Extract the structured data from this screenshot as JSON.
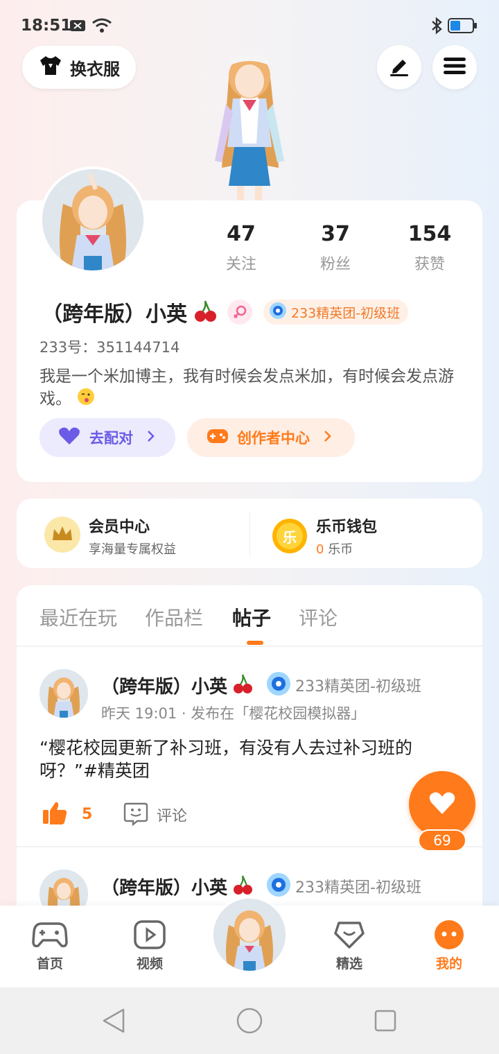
{
  "status": {
    "time": "18:51"
  },
  "header": {
    "outfit_label": "换衣服"
  },
  "profile": {
    "name": "（跨年版）小英",
    "id_line": "233号：351144714",
    "bio": "我是一个米加博主，我有时候会发点米加，有时候会发点游戏。",
    "badge": "233精英团-初级班",
    "stats": [
      {
        "value": "47",
        "label": "关注"
      },
      {
        "value": "37",
        "label": "粉丝"
      },
      {
        "value": "154",
        "label": "获赞"
      }
    ],
    "match_label": "去配对",
    "creator_label": "创作者中心"
  },
  "services": {
    "vip_title": "会员中心",
    "vip_sub": "享海量专属权益",
    "wallet_title": "乐币钱包",
    "wallet_amount": "0",
    "wallet_unit": "乐币",
    "coin_glyph": "乐"
  },
  "tabs": [
    {
      "label": "最近在玩"
    },
    {
      "label": "作品栏"
    },
    {
      "label": "帖子"
    },
    {
      "label": "评论"
    }
  ],
  "posts": [
    {
      "author": "（跨年版）小英",
      "badge": "233精英团-初级班",
      "meta": "昨天 19:01 · 发布在「樱花校园模拟器」",
      "text": "“樱花校园更新了补习班，有没有人去过补习班的呀？”#精英团",
      "likes": "5",
      "comment_label": "评论"
    },
    {
      "author": "（跨年版）小英",
      "badge": "233精英团-初级班"
    }
  ],
  "float": {
    "count": "69"
  },
  "bottom_nav": [
    {
      "label": "首页"
    },
    {
      "label": "视频"
    },
    {
      "label": "精选"
    },
    {
      "label": "我的"
    }
  ],
  "colors": {
    "accent": "#ff7a1a",
    "purple": "#6a5ce6",
    "badge_bg": "#fff0e6"
  }
}
